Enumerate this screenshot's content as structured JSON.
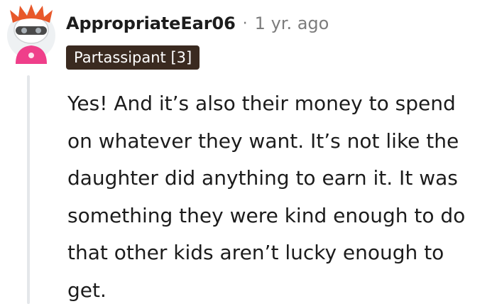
{
  "comment": {
    "username": "AppropriateEar06",
    "separator": "·",
    "timestamp": "1 yr. ago",
    "flair": "Partassipant [3]",
    "body": "Yes! And it’s also their money to spend on whatever they want. It’s not like the daughter did anything to earn it. It was something they were kind enough to do that other kids aren’t lucky enough to get."
  },
  "colors": {
    "flair_background": "#3a2a20",
    "thread_line": "#e4e7ea",
    "meta_text": "#7c7c7c",
    "avatar_hair": "#e8582a",
    "avatar_shirt": "#ef3f8a"
  },
  "icons": {
    "avatar": "snoo-avatar-icon"
  }
}
